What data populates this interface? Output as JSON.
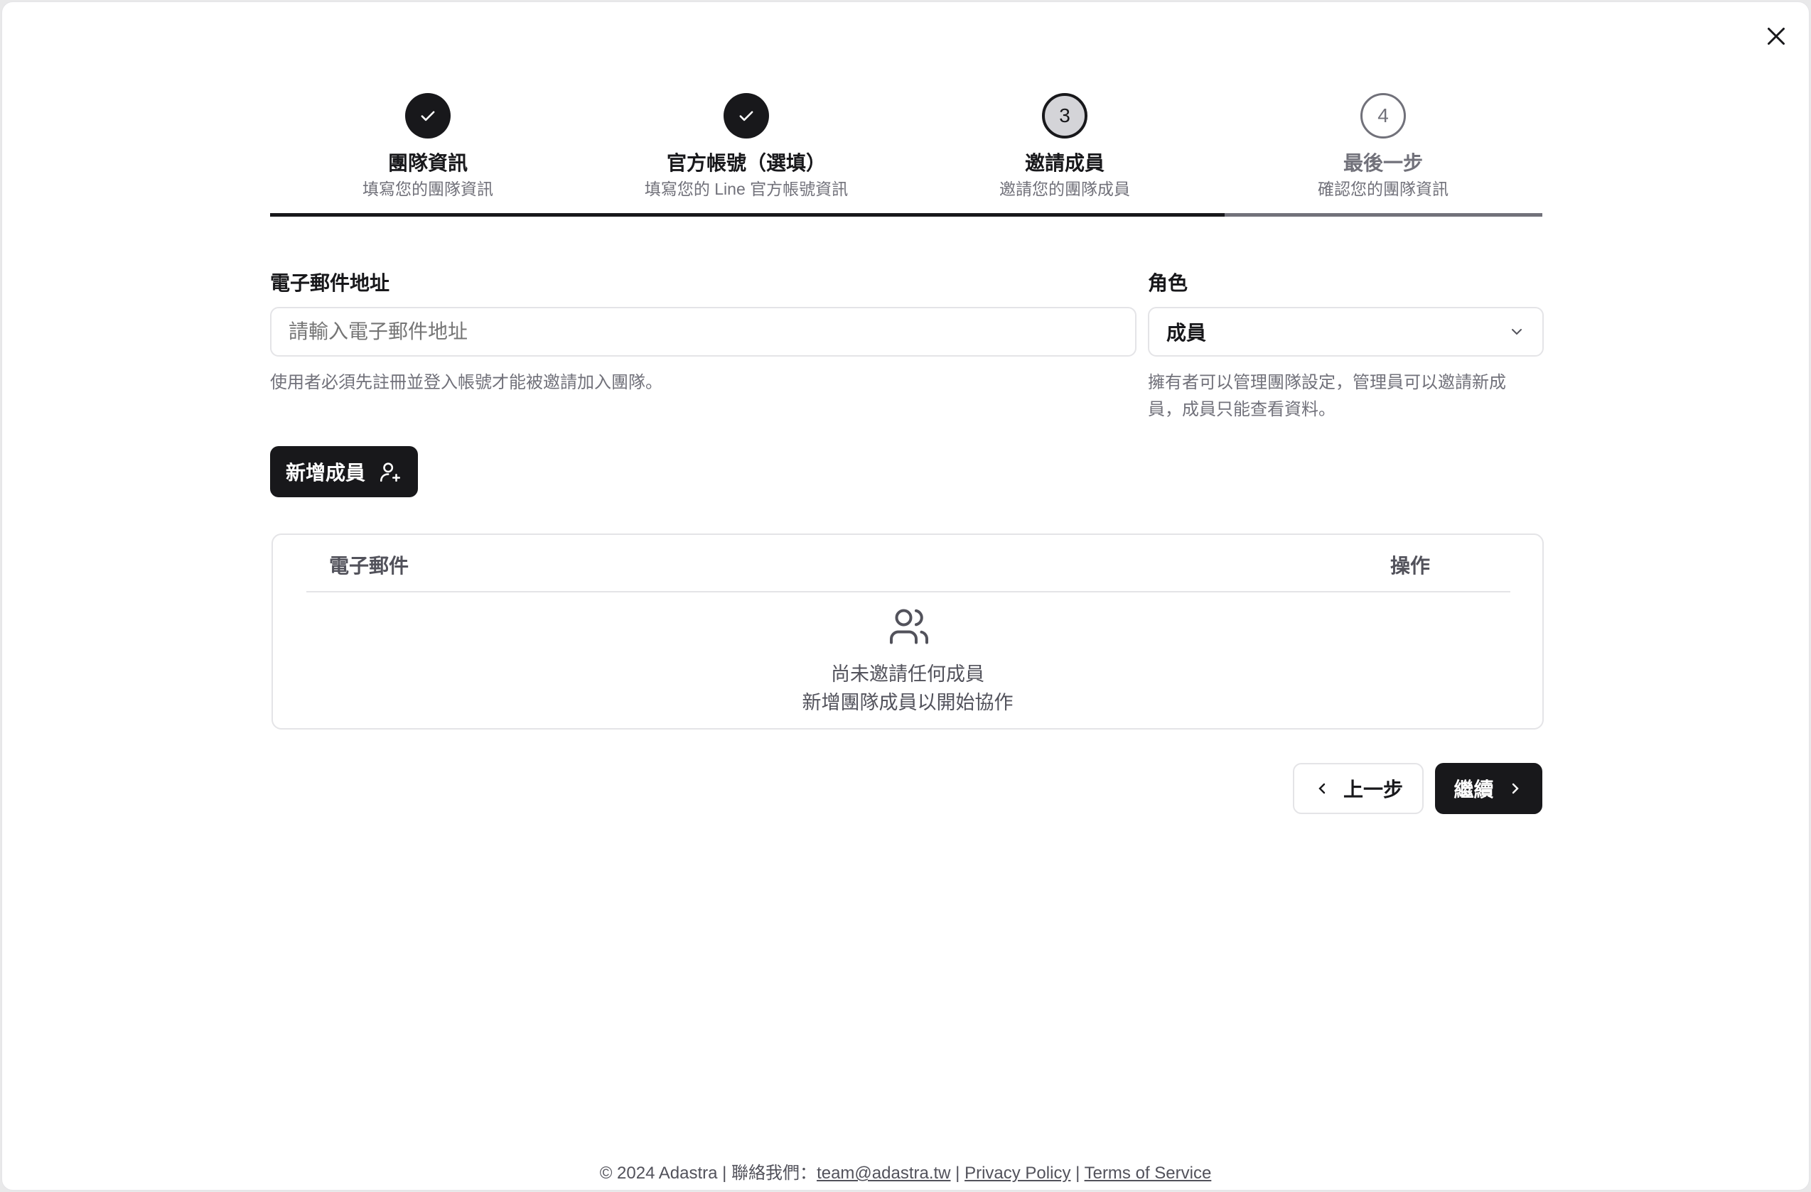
{
  "steps": [
    {
      "title": "團隊資訊",
      "subtitle": "填寫您的團隊資訊",
      "state": "done"
    },
    {
      "title": "官方帳號（選填）",
      "subtitle": "填寫您的 Line 官方帳號資訊",
      "state": "done"
    },
    {
      "number": "3",
      "title": "邀請成員",
      "subtitle": "邀請您的團隊成員",
      "state": "current"
    },
    {
      "number": "4",
      "title": "最後一步",
      "subtitle": "確認您的團隊資訊",
      "state": "todo"
    }
  ],
  "progress_percent": 75,
  "email": {
    "label": "電子郵件地址",
    "placeholder": "請輸入電子郵件地址",
    "value": "",
    "help": "使用者必須先註冊並登入帳號才能被邀請加入團隊。"
  },
  "role": {
    "label": "角色",
    "value": "成員",
    "help_line1": "擁有者可以管理團隊設定，管理員可以邀請新成",
    "help_line2": "員，成員只能查看資料。"
  },
  "add_button": "新增成員",
  "table": {
    "columns": [
      "電子郵件",
      "操作"
    ],
    "empty_title": "尚未邀請任何成員",
    "empty_subtitle": "新增團隊成員以開始協作"
  },
  "nav": {
    "back": "上一步",
    "next": "繼續"
  },
  "footer": {
    "copyright": "© 2024 Adastra | 聯絡我們：",
    "email": "team@adastra.tw",
    "sep": " | ",
    "privacy": "Privacy Policy",
    "terms": "Terms of Service"
  }
}
